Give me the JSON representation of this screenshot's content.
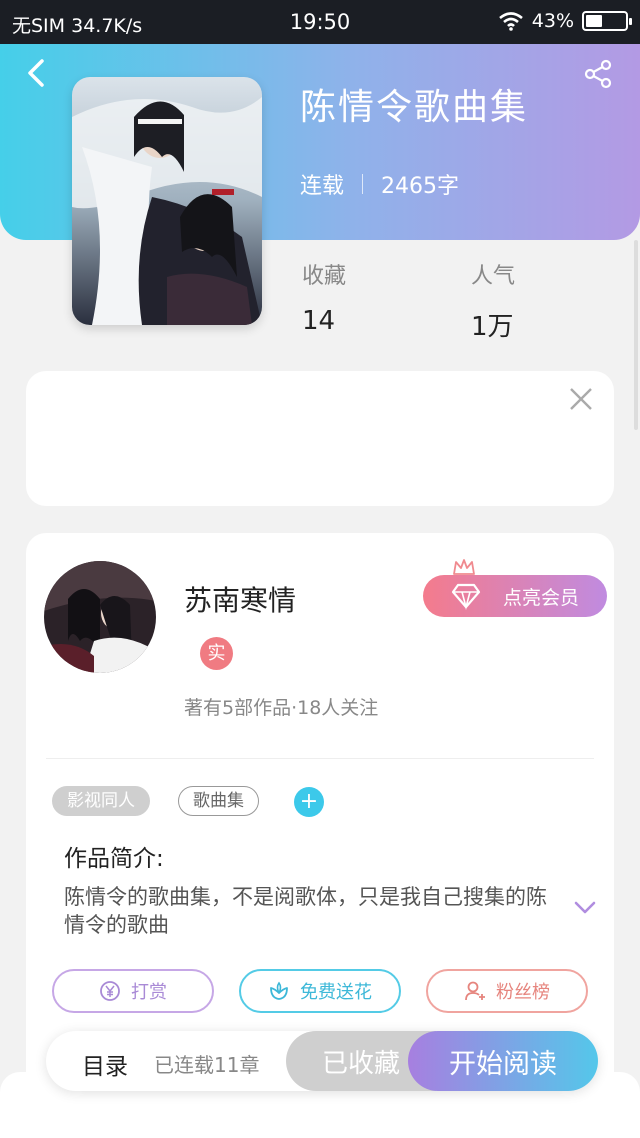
{
  "status_bar": {
    "carrier": "无SIM",
    "speed": "34.7K/s",
    "time": "19:50",
    "battery": "43%",
    "battery_level": 0.43
  },
  "book": {
    "title": "陈情令歌曲集",
    "status": "连载",
    "word_count": "2465字",
    "favorites_label": "收藏",
    "favorites_value": "14",
    "popularity_label": "人气",
    "popularity_value": "1万"
  },
  "author": {
    "name": "苏南寒情",
    "verify_badge": "实",
    "stats": "著有5部作品·18人关注",
    "vip_button": "点亮会员"
  },
  "tags": [
    "影视同人",
    "歌曲集"
  ],
  "tag_add": "+",
  "intro": {
    "label": "作品简介:",
    "text": "陈情令的歌曲集，不是阅歌体，只是我自己搜集的陈情令的歌曲"
  },
  "actions": {
    "tip": "打赏",
    "flower": "免费送花",
    "fans": "粉丝榜"
  },
  "bottom": {
    "catalog": "目录",
    "chapters": "已连载11章",
    "collected": "已收藏",
    "read": "开始阅读"
  },
  "colors": {
    "header_start": "#45cfe9",
    "header_end": "#b39ae4",
    "accent_blue": "#3cc9ea",
    "accent_purple": "#a77fe0",
    "vip_pink": "#f47b8c"
  },
  "icons": [
    "back-arrow-icon",
    "share-icon",
    "close-icon",
    "crown-icon",
    "diamond-icon",
    "plus-icon",
    "chevron-down-icon",
    "yen-coin-icon",
    "flower-icon",
    "user-rank-icon",
    "wifi-icon",
    "battery-icon"
  ]
}
